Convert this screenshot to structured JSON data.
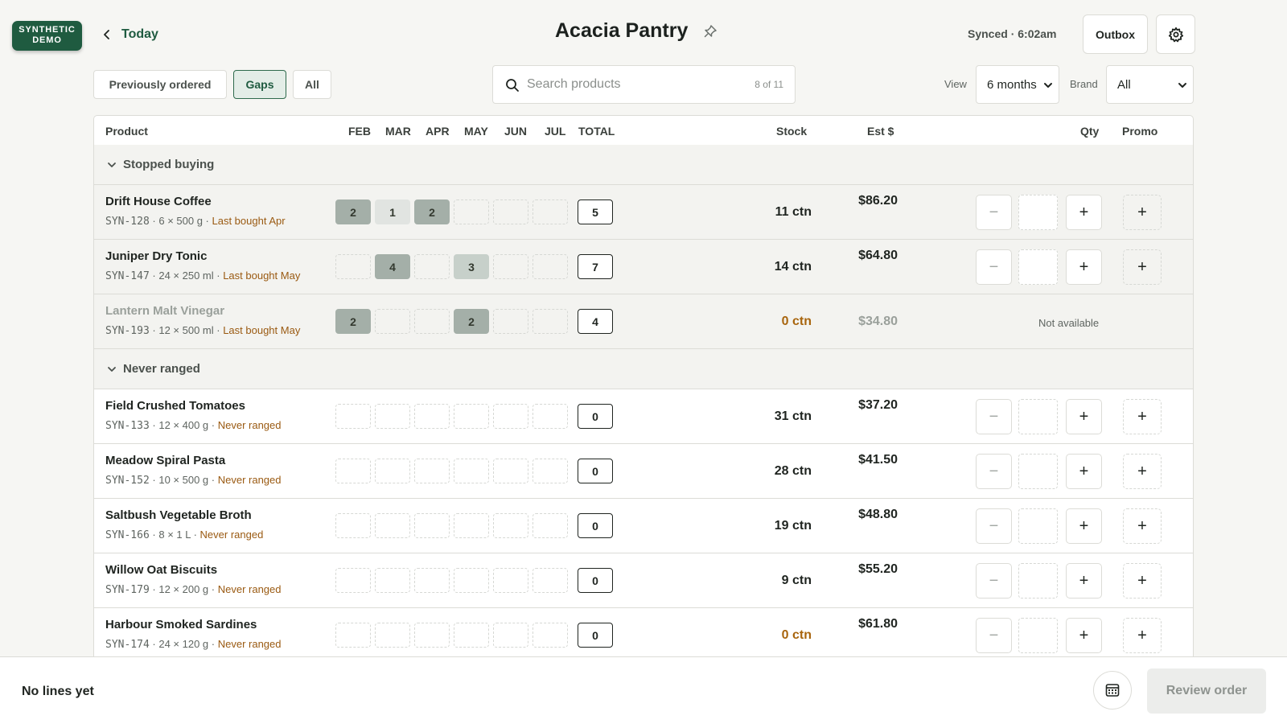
{
  "badge": {
    "line1": "SYNTHETIC",
    "line2": "DEMO"
  },
  "nav": {
    "back_label": "Today"
  },
  "header": {
    "title": "Acacia Pantry",
    "sync_status": "Synced · 6:02am",
    "outbox_label": "Outbox"
  },
  "filters": {
    "tabs": [
      {
        "label": "Previously ordered",
        "active": false
      },
      {
        "label": "Gaps",
        "active": true
      },
      {
        "label": "All",
        "active": false
      }
    ]
  },
  "search": {
    "placeholder": "Search products",
    "count": "8 of 11"
  },
  "view": {
    "label": "View",
    "value": "6 months"
  },
  "brand": {
    "label": "Brand",
    "value": "All"
  },
  "columns": {
    "product": "Product",
    "months": [
      "FEB",
      "MAR",
      "APR",
      "MAY",
      "JUN",
      "JUL"
    ],
    "total": "TOTAL",
    "stock": "Stock",
    "est": "Est $",
    "qty": "Qty",
    "promo": "Promo"
  },
  "groups": [
    {
      "label": "Stopped buying",
      "rows": [
        {
          "name": "Drift House Coffee",
          "code": "SYN-128",
          "pack": " · 6 × 500 g · ",
          "note": "Last bought Apr",
          "months": [
            "2",
            "1",
            "2",
            "",
            "",
            ""
          ],
          "total": "5",
          "stock": "11 ctn",
          "est": "$86.20",
          "available": true
        },
        {
          "name": "Juniper Dry Tonic",
          "code": "SYN-147",
          "pack": " · 24 × 250 ml · ",
          "note": "Last bought May",
          "months": [
            "",
            "4",
            "",
            "3",
            "",
            ""
          ],
          "total": "7",
          "stock": "14 ctn",
          "est": "$64.80",
          "available": true
        },
        {
          "name": "Lantern Malt Vinegar",
          "code": "SYN-193",
          "pack": " · 12 × 500 ml · ",
          "note": "Last bought May",
          "months": [
            "2",
            "",
            "",
            "2",
            "",
            ""
          ],
          "total": "4",
          "stock": "0 ctn",
          "est": "$34.80",
          "available": false,
          "unavailable_label": "Not available"
        }
      ]
    },
    {
      "label": "Never ranged",
      "rows": [
        {
          "name": "Field Crushed Tomatoes",
          "code": "SYN-133",
          "pack": " · 12 × 400 g · ",
          "note": "Never ranged",
          "months": [
            "",
            "",
            "",
            "",
            "",
            ""
          ],
          "total": "0",
          "stock": "31 ctn",
          "est": "$37.20",
          "available": true
        },
        {
          "name": "Meadow Spiral Pasta",
          "code": "SYN-152",
          "pack": " · 10 × 500 g · ",
          "note": "Never ranged",
          "months": [
            "",
            "",
            "",
            "",
            "",
            ""
          ],
          "total": "0",
          "stock": "28 ctn",
          "est": "$41.50",
          "available": true
        },
        {
          "name": "Saltbush Vegetable Broth",
          "code": "SYN-166",
          "pack": " · 8 × 1 L · ",
          "note": "Never ranged",
          "months": [
            "",
            "",
            "",
            "",
            "",
            ""
          ],
          "total": "0",
          "stock": "19 ctn",
          "est": "$48.80",
          "available": true
        },
        {
          "name": "Willow Oat Biscuits",
          "code": "SYN-179",
          "pack": " · 12 × 200 g · ",
          "note": "Never ranged",
          "months": [
            "",
            "",
            "",
            "",
            "",
            ""
          ],
          "total": "0",
          "stock": "9 ctn",
          "est": "$55.20",
          "available": true
        },
        {
          "name": "Harbour Smoked Sardines",
          "code": "SYN-174",
          "pack": " · 24 × 120 g · ",
          "note": "Never ranged",
          "months": [
            "",
            "",
            "",
            "",
            "",
            ""
          ],
          "total": "0",
          "stock": "0 ctn",
          "est": "$61.80",
          "available": true
        }
      ]
    }
  ],
  "footer": {
    "status": "No lines yet",
    "review_label": "Review order"
  },
  "colors": {
    "brand": "#1f5b40",
    "warning": "#a8650e",
    "cell_high": "#a4afa8",
    "cell_mid": "#c7d0ca",
    "cell_low": "#e1e4e1"
  }
}
